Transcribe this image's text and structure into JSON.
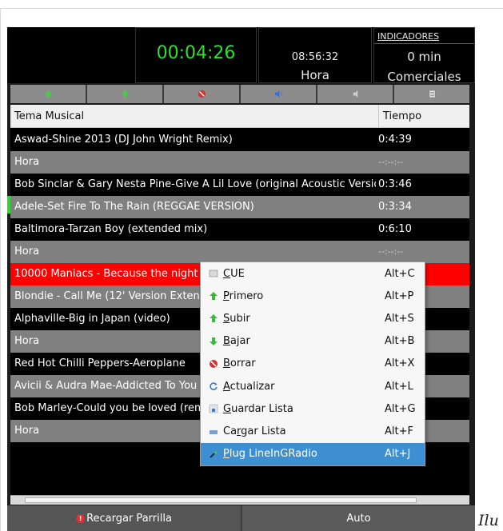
{
  "header": {
    "elapsed_timer": "00:04:26",
    "clock_time": "08:56:32",
    "clock_label": "Hora",
    "indicators_title": "INDICADORES",
    "indicators_value": "0 min",
    "indicators_label": "Comerciales"
  },
  "toolbar": {
    "buttons": [
      "move-up-icon",
      "move-down-icon",
      "delete-icon",
      "volume-icon",
      "speaker-icon",
      "list-icon"
    ]
  },
  "table": {
    "columns": [
      "Tema Musical",
      "Tiempo"
    ],
    "rows": [
      {
        "title": "Aswad-Shine 2013 (DJ John Wright Remix)",
        "time": "0:4:39",
        "style": "dark"
      },
      {
        "title": "Hora",
        "time": "--:--:--",
        "style": "gray"
      },
      {
        "title": "Bob Sinclar & Gary Nesta Pine-Give A Lil Love (original Acoustic Version)",
        "time": "0:3:46",
        "style": "dark"
      },
      {
        "title": "Adele-Set Fire To The Rain (REGGAE VERSION)",
        "time": "0:3:34",
        "style": "gray"
      },
      {
        "title": "Baltimora-Tarzan Boy (extended mix)",
        "time": "0:6:10",
        "style": "dark"
      },
      {
        "title": "Hora",
        "time": "--:--:--",
        "style": "gray"
      },
      {
        "title": "10000 Maniacs - Because the night",
        "time": "",
        "style": "red"
      },
      {
        "title": "Blondie - Call Me (12' Version Extended)",
        "time": "",
        "style": "gray"
      },
      {
        "title": "Alphaville-Big in Japan (video)",
        "time": "",
        "style": "dark"
      },
      {
        "title": "Hora",
        "time": "",
        "style": "gray"
      },
      {
        "title": "Red Hot Chilli Peppers-Aeroplane",
        "time": "",
        "style": "dark"
      },
      {
        "title": "Avicii & Audra Mae-Addicted To You",
        "time": "",
        "style": "gray"
      },
      {
        "title": "Bob Marley-Could you be loved (remix)",
        "time": "",
        "style": "dark"
      },
      {
        "title": "Hora",
        "time": "",
        "style": "gray"
      }
    ]
  },
  "context_menu": {
    "items": [
      {
        "label": "CUE",
        "shortcut": "Alt+C",
        "icon": "cue-icon"
      },
      {
        "label": "Primero",
        "shortcut": "Alt+P",
        "icon": "first-icon"
      },
      {
        "label": "Subir",
        "shortcut": "Alt+S",
        "icon": "up-icon"
      },
      {
        "label": "Bajar",
        "shortcut": "Alt+B",
        "icon": "down-icon"
      },
      {
        "label": "Borrar",
        "shortcut": "Alt+X",
        "icon": "delete-icon"
      },
      {
        "label": "Actualizar",
        "shortcut": "Alt+L",
        "icon": "refresh-icon"
      },
      {
        "label": "Guardar Lista",
        "shortcut": "Alt+G",
        "icon": "save-icon"
      },
      {
        "label": "Cargar Lista",
        "shortcut": "Alt+F",
        "icon": "load-icon"
      },
      {
        "label": "Plug LineInGRadio",
        "shortcut": "Alt+J",
        "icon": "plug-icon",
        "active": true
      }
    ]
  },
  "bottom": {
    "reload_label": "Recargar Parrilla",
    "auto_label": "Auto"
  },
  "caption": "Ilu",
  "colors": {
    "timer": "#2ee02e",
    "selected_row": "#ff0000",
    "menu_active": "#3d8fd1"
  }
}
